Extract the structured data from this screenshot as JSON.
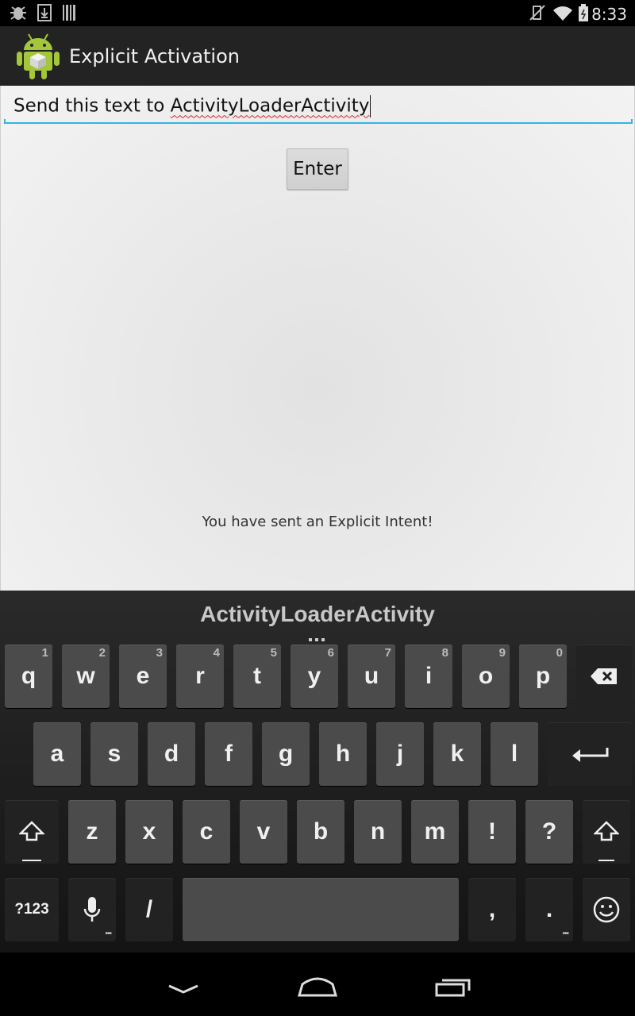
{
  "status_bar": {
    "time": "8:33",
    "left_icons": [
      "bug-icon",
      "download-icon",
      "barcode-icon"
    ],
    "right_icons": [
      "vibrate-icon",
      "wifi-icon",
      "battery-icon"
    ]
  },
  "action_bar": {
    "title": "Explicit Activation",
    "icon": "android-app-icon"
  },
  "main": {
    "input_prefix": "Send this text to ",
    "input_underlined": "ActivityLoaderActivity",
    "enter_label": "Enter",
    "result_message": "You have sent an Explicit Intent!"
  },
  "keyboard": {
    "suggestion": "ActivityLoaderActivity",
    "row1": [
      {
        "label": "q",
        "hint": "1"
      },
      {
        "label": "w",
        "hint": "2"
      },
      {
        "label": "e",
        "hint": "3"
      },
      {
        "label": "r",
        "hint": "4"
      },
      {
        "label": "t",
        "hint": "5"
      },
      {
        "label": "y",
        "hint": "6"
      },
      {
        "label": "u",
        "hint": "7"
      },
      {
        "label": "i",
        "hint": "8"
      },
      {
        "label": "o",
        "hint": "9"
      },
      {
        "label": "p",
        "hint": "0"
      }
    ],
    "row2": [
      "a",
      "s",
      "d",
      "f",
      "g",
      "h",
      "j",
      "k",
      "l"
    ],
    "row3": [
      "z",
      "x",
      "c",
      "v",
      "b",
      "n",
      "m",
      "!",
      "?"
    ],
    "symbols_label": "?123",
    "slash_label": "/",
    "comma_label": ",",
    "period_label": "."
  },
  "colors": {
    "accent": "#33b5e5",
    "key": "#4b4b4b",
    "key_dark": "#222222"
  }
}
